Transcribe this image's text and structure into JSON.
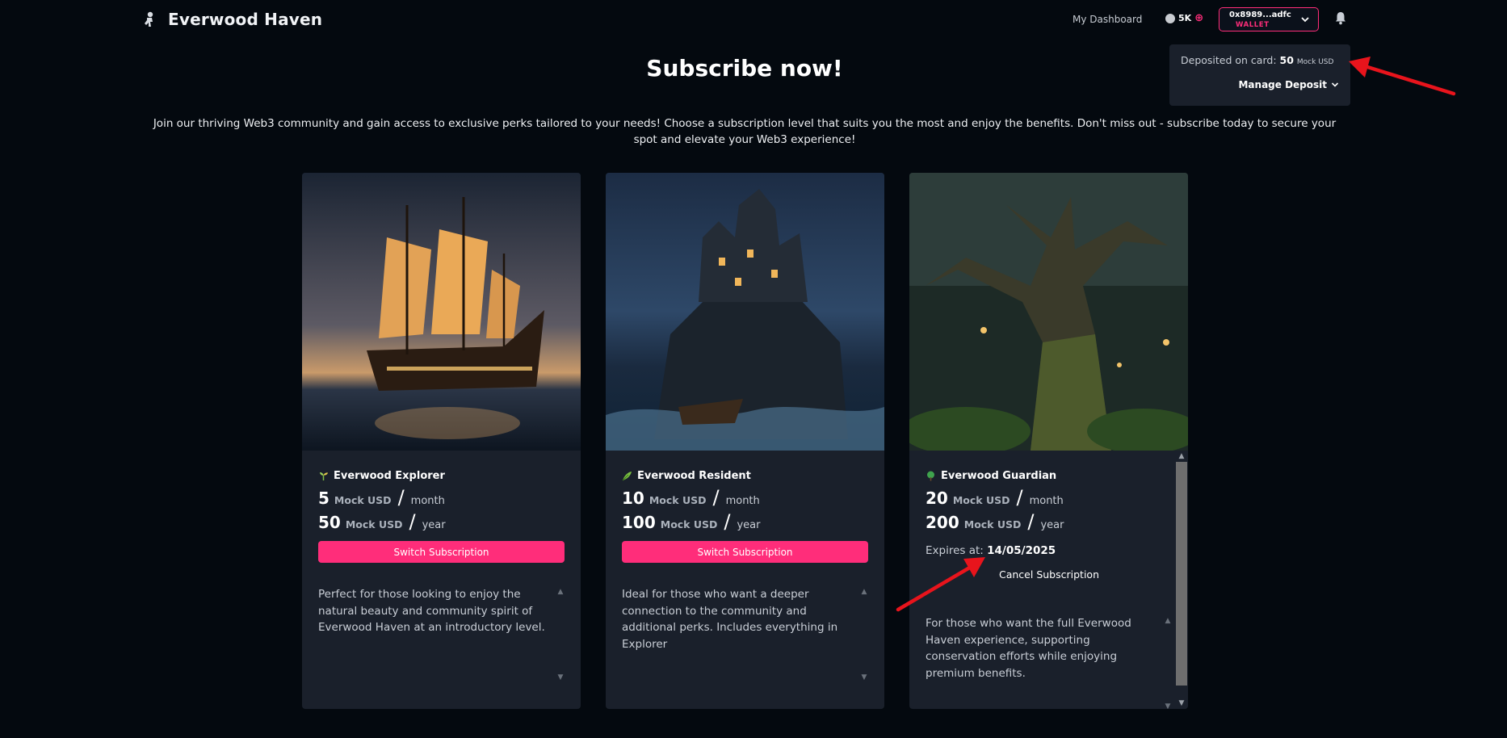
{
  "header": {
    "brand": "Everwood Haven",
    "brand_icon": "astronaut-icon",
    "nav_dashboard": "My Dashboard",
    "points": "5K",
    "wallet_address": "0x8989...adfc",
    "wallet_label": "WALLET"
  },
  "deposit": {
    "label": "Deposited on card:",
    "amount": "50",
    "unit": "Mock USD",
    "manage_label": "Manage Deposit"
  },
  "hero": {
    "title": "Subscribe now!",
    "subtitle": "Join our thriving Web3 community and gain access to exclusive perks tailored to your needs! Choose a subscription level that suits you the most and enjoy the benefits. Don't miss out - subscribe today to secure your spot and elevate your Web3 experience!"
  },
  "colors": {
    "background": "#04090f",
    "card": "#1a202b",
    "accent": "#ff2d7a"
  },
  "plans": [
    {
      "name": "Everwood Explorer",
      "icon": "sprout-icon",
      "monthly_price": "5",
      "yearly_price": "50",
      "unit": "Mock USD",
      "month_label": "month",
      "year_label": "year",
      "action": "Switch Subscription",
      "description": "Perfect for those looking to enjoy the natural beauty and community spirit of Everwood Haven at an introductory level."
    },
    {
      "name": "Everwood Resident",
      "icon": "leaf-icon",
      "monthly_price": "10",
      "yearly_price": "100",
      "unit": "Mock USD",
      "month_label": "month",
      "year_label": "year",
      "action": "Switch Subscription",
      "description": "Ideal for those who want a deeper connection to the community and additional perks. Includes everything in Explorer"
    },
    {
      "name": "Everwood Guardian",
      "icon": "tree-icon",
      "monthly_price": "20",
      "yearly_price": "200",
      "unit": "Mock USD",
      "month_label": "month",
      "year_label": "year",
      "expires_label": "Expires at:",
      "expires_date": "14/05/2025",
      "action": "Cancel Subscription",
      "description": "For those who want the full Everwood Haven experience, supporting conservation efforts while enjoying premium benefits."
    }
  ]
}
